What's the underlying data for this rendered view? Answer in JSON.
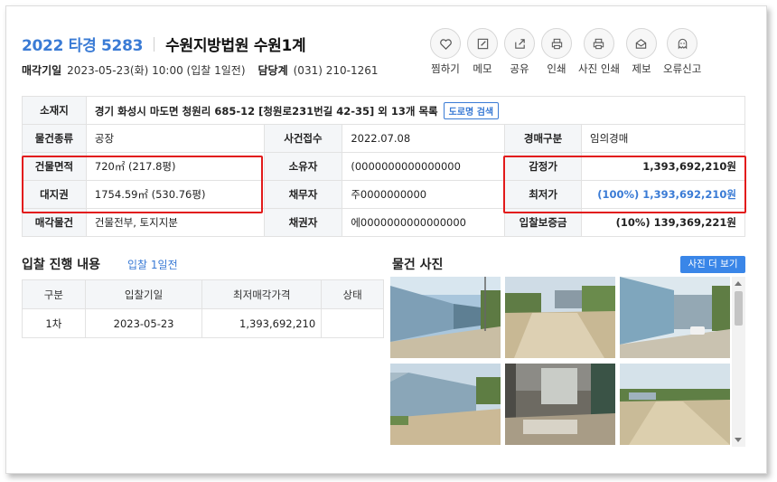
{
  "header": {
    "case_no": "2022 타경 5283",
    "court": "수원지방법원 수원1계",
    "sale_date_label": "매각기일",
    "sale_date_value": "2023-05-23(화) 10:00 (입찰 1일전)",
    "dept_label": "담당계",
    "dept_value": "(031) 210-1261"
  },
  "toolbar": [
    {
      "label": "찜하기",
      "icon": "heart-icon"
    },
    {
      "label": "메모",
      "icon": "pencil-icon"
    },
    {
      "label": "공유",
      "icon": "share-icon"
    },
    {
      "label": "인쇄",
      "icon": "printer-icon"
    },
    {
      "label": "사진 인쇄",
      "icon": "printer-icon"
    },
    {
      "label": "제보",
      "icon": "envelope-icon"
    },
    {
      "label": "오류신고",
      "icon": "ghost-icon"
    }
  ],
  "info": {
    "location_label": "소재지",
    "location_value": "경기 화성시 마도면 청원리 685-12 [청원로231번길 42-35] 외 13개 목록",
    "road_search": "도로명 검색",
    "rows": [
      {
        "l1": "물건종류",
        "v1": "공장",
        "l2": "사건접수",
        "v2": "2022.07.08",
        "l3": "경매구분",
        "v3": "임의경매"
      },
      {
        "l1": "건물면적",
        "v1": "720㎡ (217.8평)",
        "l2": "소유자",
        "v2": "(0000000000000000",
        "l3": "감정가",
        "v3": "1,393,692,210원"
      },
      {
        "l1": "대지권",
        "v1": "1754.59㎡ (530.76평)",
        "l2": "채무자",
        "v2": "주0000000000",
        "l3": "최저가",
        "v3": "(100%) 1,393,692,210원"
      },
      {
        "l1": "매각물건",
        "v1": "건물전부, 토지지분",
        "l2": "채권자",
        "v2": "에0000000000000000",
        "l3": "입찰보증금",
        "v3": "(10%) 139,369,221원"
      }
    ]
  },
  "bid": {
    "title": "입찰 진행 내용",
    "sub": "입찰 1일전",
    "headers": [
      "구분",
      "입찰기일",
      "최저매각가격",
      "상태"
    ],
    "rows": [
      [
        "1차",
        "2023-05-23",
        "1,393,692,210",
        ""
      ]
    ]
  },
  "photos": {
    "title": "물건 사진",
    "more": "사진 더 보기"
  },
  "colors": {
    "accent": "#3a7bd5",
    "highlight_box": "#e21a1a"
  }
}
